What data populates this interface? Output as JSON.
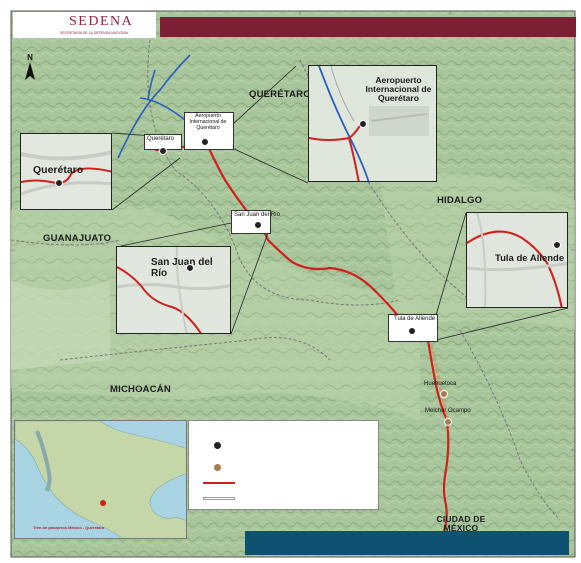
{
  "header": {
    "brand": "SEDENA",
    "subtitle": "SECRETARÍA DE LA DEFENSA NACIONAL"
  },
  "regions": {
    "queretaro": "QUERÉTARO",
    "hidalgo": "HIDALGO",
    "guanajuato": "GUANAJUATO",
    "michoacan": "MICHOACÁN",
    "cdmx": "CIUDAD DE MÉXICO"
  },
  "stations": {
    "queretaro": "Querétaro",
    "aeropuerto": "Aeropuerto Internacional de Querétaro",
    "san_juan": "San Juan del Río",
    "tula": "Tula de Allende",
    "huehuetoca": "Huehuetoca",
    "melchor": "Melchor Ocampo"
  },
  "callouts": {
    "aeropuerto_title": "Aeropuerto Internacional de Querétaro",
    "queretaro_title": "Querétaro",
    "san_juan_title": "San Juan del Río",
    "tula_title": "Tula de Allende"
  },
  "mini_map": {
    "caption": "Tren de pasajeros México - Querétaro"
  },
  "colors": {
    "rail_route": "#d0201e",
    "existing_route": "#2a5fbf",
    "header_band": "#7b1f35",
    "brand": "#9b1d3c",
    "bottom_bar": "#0e5170",
    "terrain": "#9fbf95"
  },
  "icons": {
    "station": "station-icon",
    "station_existing": "station-tan-icon",
    "north_arrow": "north-arrow-icon"
  }
}
